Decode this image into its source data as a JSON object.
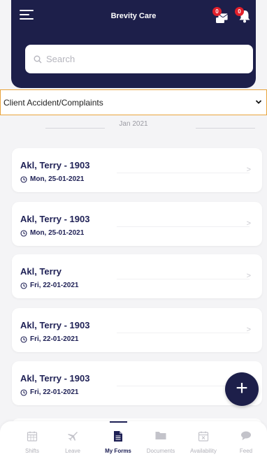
{
  "header": {
    "title": "Brevity Care",
    "messages_badge": "0",
    "notifications_badge": "0"
  },
  "search": {
    "placeholder": "Search",
    "value": ""
  },
  "form_type": {
    "selected": "Client Accident/Complaints"
  },
  "month_separator": "Jan 2021",
  "forms": [
    {
      "name": "Akl, Terry - 1903",
      "date": "Mon, 25-01-2021"
    },
    {
      "name": "Akl, Terry - 1903",
      "date": "Mon, 25-01-2021"
    },
    {
      "name": "Akl, Terry",
      "date": "Fri, 22-01-2021"
    },
    {
      "name": "Akl, Terry - 1903",
      "date": "Fri, 22-01-2021"
    },
    {
      "name": "Akl, Terry - 1903",
      "date": "Fri, 22-01-2021"
    }
  ],
  "fab_label": "+",
  "tabs": [
    {
      "label": "Shifts",
      "icon": "calendar-icon",
      "active": false
    },
    {
      "label": "Leave",
      "icon": "plane-icon",
      "active": false
    },
    {
      "label": "My Forms",
      "icon": "document-icon",
      "active": true
    },
    {
      "label": "Documents",
      "icon": "folder-icon",
      "active": false
    },
    {
      "label": "Availability",
      "icon": "calendar-x-icon",
      "active": false
    },
    {
      "label": "Feed",
      "icon": "chat-icon",
      "active": false
    }
  ],
  "colors": {
    "header_bg": "#1d1f4a",
    "accent_text": "#1e2055",
    "badge": "#e0202b",
    "select_border": "#e8a33b"
  }
}
